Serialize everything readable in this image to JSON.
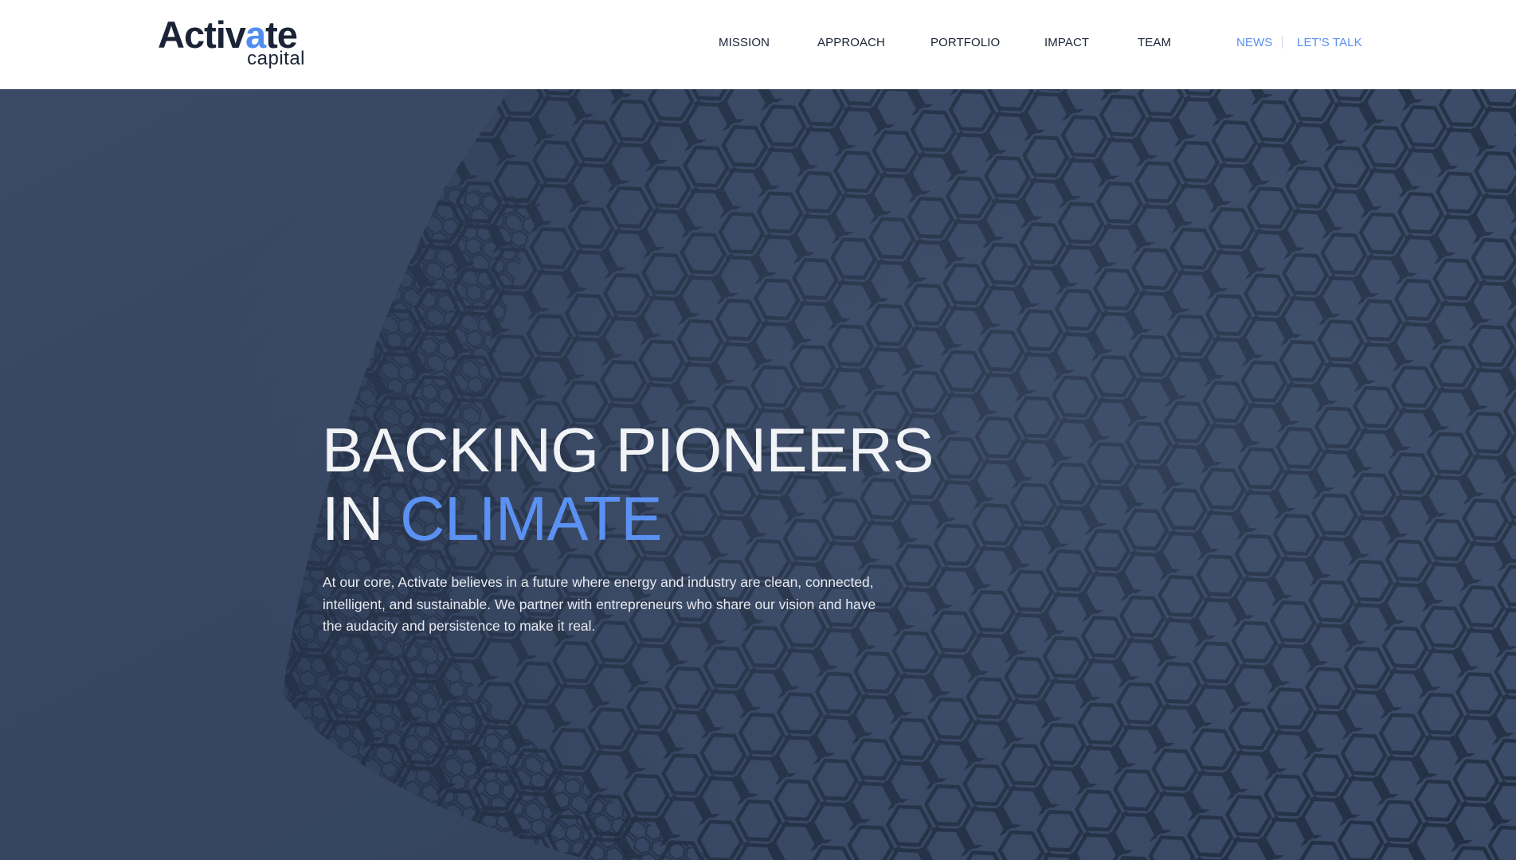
{
  "logo": {
    "word_start": "Activ",
    "word_accent": "a",
    "word_end": "te",
    "sub": "capital"
  },
  "nav": {
    "items": [
      {
        "label": "MISSION"
      },
      {
        "label": "APPROACH"
      },
      {
        "label": "PORTFOLIO"
      },
      {
        "label": "IMPACT"
      },
      {
        "label": "TEAM"
      }
    ],
    "news": "NEWS",
    "lets_talk": "LET'S TALK"
  },
  "hero": {
    "title_line1": "BACKING PIONEERS",
    "title_line2_prefix": "IN",
    "title_line2_highlight": "CLIMATE",
    "body": "At our core, Activate believes in a future where energy and industry are clean, connected, intelligent, and sustainable. We partner with entrepreneurs who share our vision and have the audacity and persistence to make it real."
  },
  "colors": {
    "brand_dark": "#1b2436",
    "accent_blue": "#5b91f2",
    "hero_bg": "#3a4a66"
  }
}
